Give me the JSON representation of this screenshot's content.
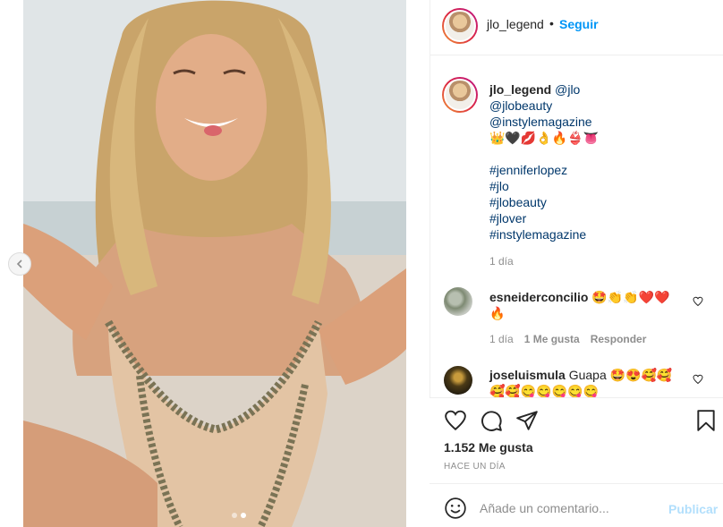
{
  "post": {
    "author": "jlo_legend",
    "separator": "•",
    "follow_label": "Seguir",
    "caption": {
      "author": "jlo_legend",
      "mention_1": "@jlo",
      "mention_2": "@jlobeauty",
      "mention_3": "@instylemagazine",
      "emojis": "👑🖤💋👌🔥👙👅",
      "hashtags": [
        "#jenniferlopez",
        "#jlo",
        "#jlobeauty",
        "#jlover",
        "#instylemagazine"
      ],
      "time": "1 día"
    },
    "comments": [
      {
        "user": "esneiderconcilio",
        "text_line1": "🤩👏👏❤️❤️",
        "text_line2": "🔥",
        "time": "1 día",
        "likes": "1 Me gusta",
        "reply_label": "Responder"
      },
      {
        "user": "joseluismula",
        "text_line1": "Guapa 🤩😍🥰🥰",
        "text_line2": "🥰🥰😋😋😋😋😋"
      }
    ],
    "likes_count": "1.152 Me gusta",
    "posted_ago": "HACE UN DÍA",
    "comment_placeholder": "Añade un comentario...",
    "publish_label": "Publicar"
  },
  "icons": {
    "like": "heart-icon",
    "comment": "comment-icon",
    "share": "paper-plane-icon",
    "save": "bookmark-icon",
    "emoji": "smiley-icon",
    "prev": "chevron-left-icon"
  },
  "colors": {
    "link_blue": "#0095f6",
    "mention_blue": "#00376b",
    "muted": "#8e8e8e",
    "publish_disabled": "#b2dffc"
  }
}
